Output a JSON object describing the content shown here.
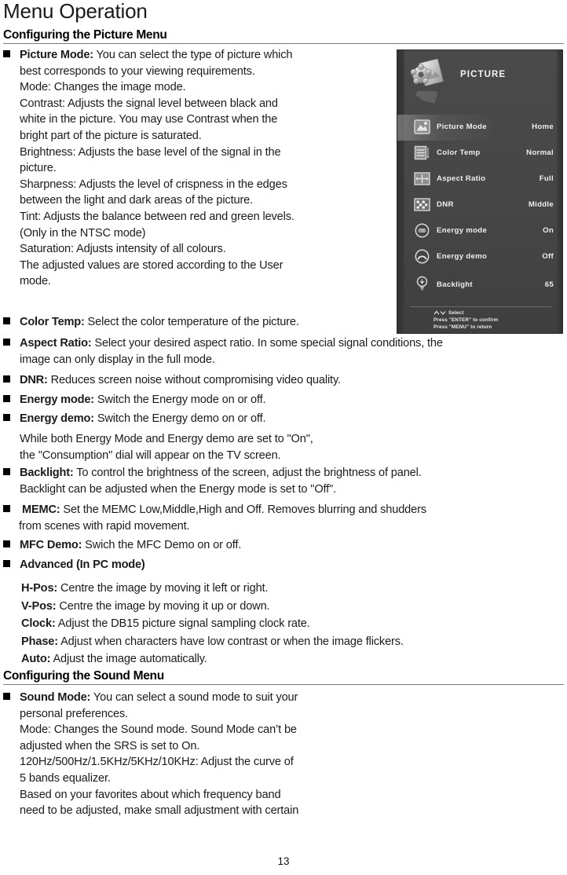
{
  "document": {
    "title": "Menu Operation",
    "page_number": "13"
  },
  "sections": {
    "picture_heading": "Configuring the Picture Menu",
    "sound_heading": "Configuring the Sound Menu"
  },
  "picture_items": {
    "picture_mode": {
      "lead": "Picture Mode:",
      "lines": [
        " You can select the type of picture which",
        "best corresponds to your viewing requirements.",
        "Mode: Changes the image mode.",
        "Contrast: Adjusts the signal level between black and",
        "white in the picture. You may use Contrast when the",
        "bright part of the picture is saturated.",
        "Brightness: Adjusts the base level of the signal in the",
        "picture.",
        "Sharpness: Adjusts the level of crispness in the edges",
        "between the light and dark areas of the picture.",
        "Tint: Adjusts the balance between red and green levels.",
        "(Only in the NTSC mode)",
        "Saturation: Adjusts intensity of all colours.",
        "The adjusted values are stored according to the User",
        "mode."
      ]
    },
    "color_temp": {
      "lead": "Color Temp:",
      "lines": [
        " Select the color temperature of the picture."
      ]
    },
    "aspect_ratio": {
      "lead": "Aspect Ratio:",
      "lines": [
        " Select your desired aspect ratio. In some special signal conditions, the",
        "image can only display in the full mode."
      ]
    },
    "dnr": {
      "lead": "DNR:",
      "lines": [
        " Reduces screen noise without compromising video quality."
      ]
    },
    "energy_mode": {
      "lead": "Energy mode:",
      "lines": [
        " Switch the Energy mode on or off."
      ]
    },
    "energy_demo": {
      "lead": "Energy demo:",
      "lines": [
        " Switch the Energy demo on or off."
      ]
    },
    "energy_note": {
      "lines": [
        "While both Energy Mode and Energy demo are set to \"On\",",
        "the \"Consumption\" dial will appear on the TV screen."
      ]
    },
    "backlight": {
      "lead": "Backlight:",
      "lines": [
        " To control the brightness of the screen, adjust the brightness of panel.",
        "Backlight can be adjusted when the Energy mode is set to \"Off\"."
      ]
    },
    "memc": {
      "lead": "MEMC:",
      "lines": [
        " Set the MEMC Low,Middle,High and Off. Removes blurring and shudders",
        "from scenes with rapid movement."
      ]
    },
    "mfc_demo": {
      "lead": "MFC Demo:",
      "lines": [
        " Swich the MFC Demo on or off."
      ]
    },
    "advanced": {
      "lead": "Advanced (In PC mode)",
      "lines": [
        ""
      ]
    },
    "advanced_sub": [
      {
        "lead": "H-Pos:",
        "text": " Centre the image by moving it left or right."
      },
      {
        "lead": "V-Pos:",
        "text": " Centre the image by moving it up or down."
      },
      {
        "lead": "Clock:",
        "text": " Adjust the DB15 picture signal sampling clock rate."
      },
      {
        "lead": "Phase:",
        "text": " Adjust when characters have low contrast or when the image flickers."
      },
      {
        "lead": "Auto:",
        "text": " Adjust the image automatically."
      }
    ]
  },
  "sound_items": {
    "sound_mode": {
      "lead": "Sound Mode:",
      "lines": [
        " You can select a sound mode to suit your",
        "personal preferences.",
        "Mode: Changes the Sound mode. Sound Mode can’t be",
        "adjusted when the SRS is set to On.",
        "120Hz/500Hz/1.5KHz/5KHz/10KHz: Adjust the curve of",
        "5 bands equalizer.",
        "Based on your favorites about which frequency band",
        "need to be adjusted, make small adjustment with certain"
      ]
    }
  },
  "osd": {
    "title": "PICTURE",
    "logo_icon": "picture-settings-icon",
    "rows": [
      {
        "icon": "picture-mode-icon",
        "label": "Picture Mode",
        "value": "Home",
        "selected": true
      },
      {
        "icon": "color-temp-icon",
        "label": "Color Temp",
        "value": "Normal",
        "selected": false
      },
      {
        "icon": "aspect-ratio-icon",
        "label": "Aspect Ratio",
        "value": "Full",
        "selected": false
      },
      {
        "icon": "dnr-icon",
        "label": "DNR",
        "value": "Middle",
        "selected": false
      },
      {
        "icon": "energy-mode-icon",
        "label": "Energy mode",
        "value": "On",
        "selected": false
      },
      {
        "icon": "energy-demo-icon",
        "label": "Energy demo",
        "value": "Off",
        "selected": false
      },
      {
        "icon": "backlight-icon",
        "label": "Backlight",
        "value": "65",
        "selected": false
      }
    ],
    "footer": {
      "select": "Select",
      "confirm": "Press \"ENTER\" to confirm",
      "return": "Press \"MENU\" to return"
    },
    "colors": {
      "panel_bg": "#464646",
      "text": "#efefef",
      "highlight": "#a0a0a0"
    }
  }
}
